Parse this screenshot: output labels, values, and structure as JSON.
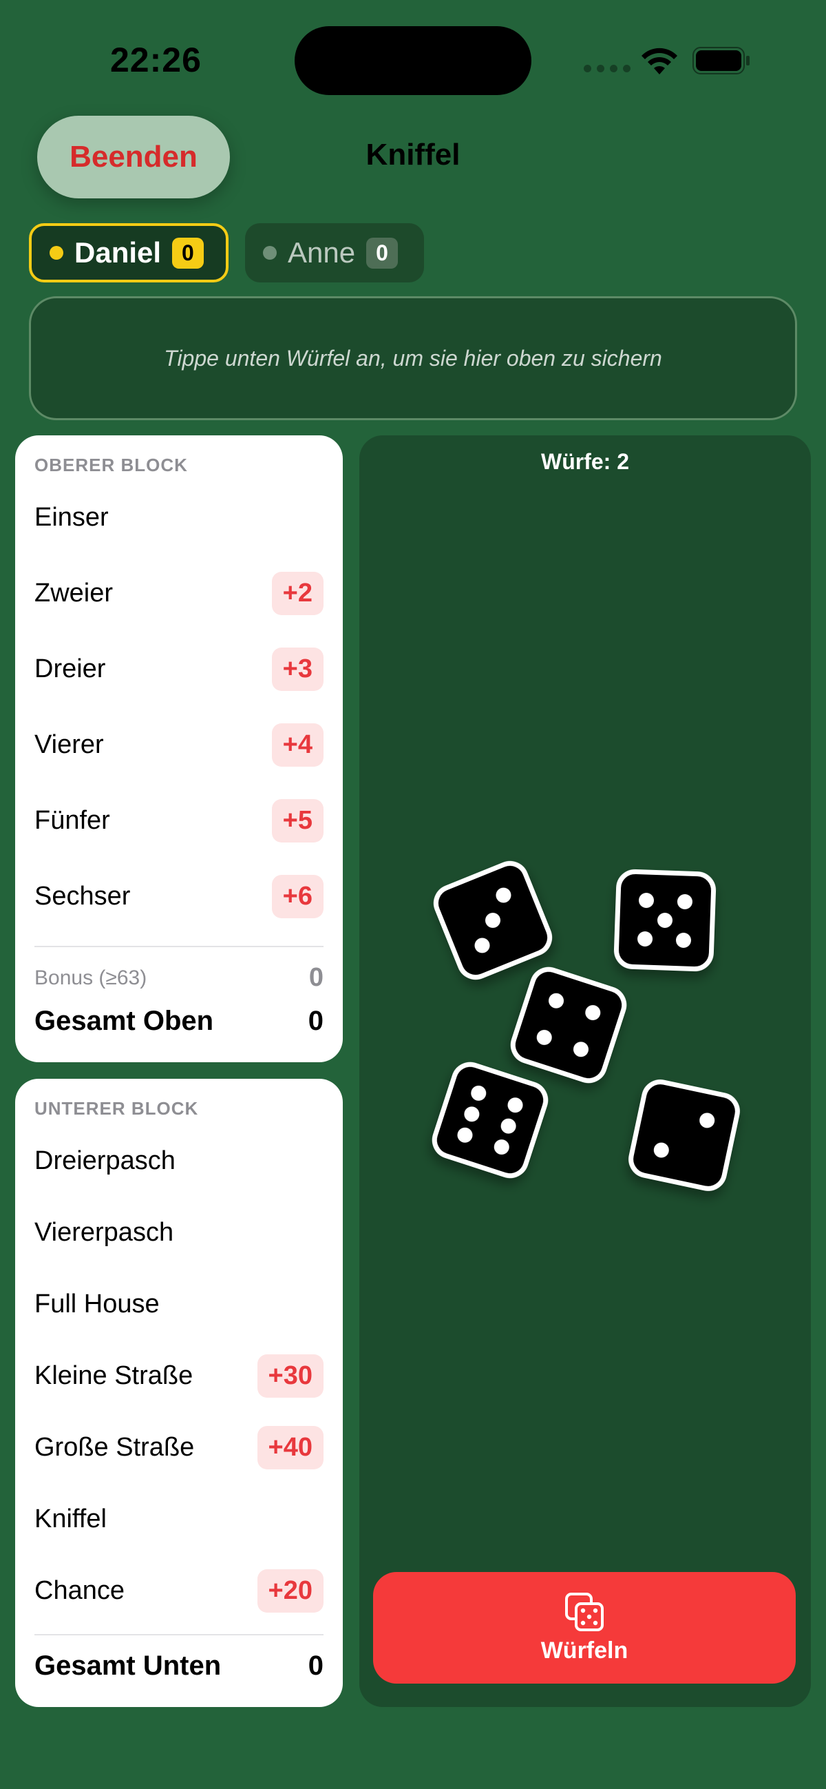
{
  "status_bar": {
    "time": "22:26"
  },
  "header": {
    "quit_label": "Beenden",
    "title": "Kniffel"
  },
  "players": [
    {
      "name": "Daniel",
      "score": "0",
      "active": true
    },
    {
      "name": "Anne",
      "score": "0",
      "active": false
    }
  ],
  "hold_area": {
    "hint": "Tippe unten Würfel an, um sie hier oben zu sichern"
  },
  "upper_block": {
    "title": "OBERER BLOCK",
    "rows": [
      {
        "label": "Einser",
        "preview": ""
      },
      {
        "label": "Zweier",
        "preview": "+2"
      },
      {
        "label": "Dreier",
        "preview": "+3"
      },
      {
        "label": "Vierer",
        "preview": "+4"
      },
      {
        "label": "Fünfer",
        "preview": "+5"
      },
      {
        "label": "Sechser",
        "preview": "+6"
      }
    ],
    "bonus_label": "Bonus (≥63)",
    "bonus_value": "0",
    "total_label": "Gesamt Oben",
    "total_value": "0"
  },
  "lower_block": {
    "title": "UNTERER BLOCK",
    "rows": [
      {
        "label": "Dreierpasch",
        "preview": ""
      },
      {
        "label": "Viererpasch",
        "preview": ""
      },
      {
        "label": "Full House",
        "preview": ""
      },
      {
        "label": "Kleine Straße",
        "preview": "+30"
      },
      {
        "label": "Große Straße",
        "preview": "+40"
      },
      {
        "label": "Kniffel",
        "preview": ""
      },
      {
        "label": "Chance",
        "preview": "+20"
      }
    ],
    "total_label": "Gesamt Unten",
    "total_value": "0"
  },
  "dice_table": {
    "throws_text": "Würfe: 2",
    "dice": [
      3,
      5,
      4,
      6,
      2
    ],
    "roll_label": "Würfeln"
  },
  "colors": {
    "background": "#23633a",
    "table": "#1c4c2d",
    "accent_red": "#f53a3a",
    "active_player": "#f5cc15"
  }
}
